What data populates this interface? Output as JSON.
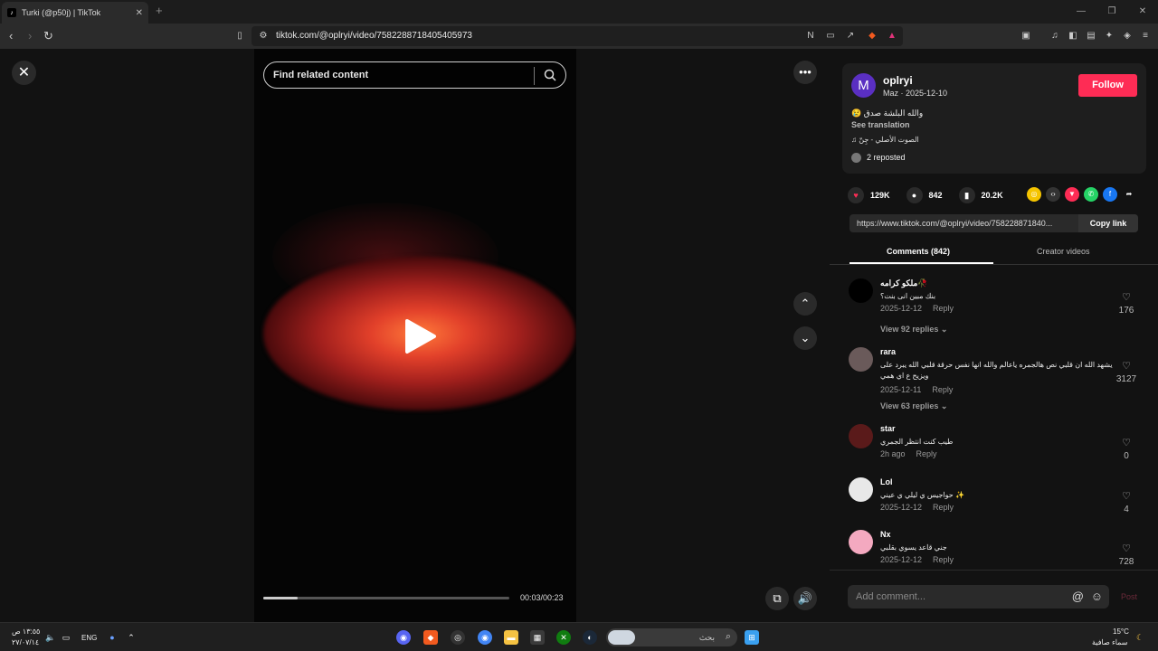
{
  "browser": {
    "tab_title": "Turki (@p50j) | TikTok",
    "url": "tiktok.com/@oplryi/video/7582288718405405973"
  },
  "video": {
    "search_placeholder": "Find related content",
    "time": "00:03/00:23",
    "progress_fraction": 0.14
  },
  "post": {
    "avatar_letter": "M",
    "username": "oplryi",
    "subline": "Maz · 2025-12-10",
    "caption": "😢 والله البلشة صدق",
    "see_translation": "See translation",
    "music": "♫  الصوت الأصلي - جِنّ",
    "reposted": "2 reposted",
    "follow_label": "Follow",
    "likes": "129K",
    "comments_count": "842",
    "saves": "20.2K",
    "share_link": "https://www.tiktok.com/@oplryi/video/758228871840...",
    "copy_link_label": "Copy link"
  },
  "tabs": {
    "comments": "Comments (842)",
    "creator_videos": "Creator videos"
  },
  "comments": [
    {
      "user": "ملكو كرامه🥀",
      "text": "بنك مبين انى بنت؟",
      "date": "2025-12-12",
      "reply": "Reply",
      "likes": "176",
      "replies": "View 92 replies ⌄",
      "avatar_color": "#000000"
    },
    {
      "user": "rara",
      "text": "يشهد الله ان قلبي نص هالجمره ياعالم والله انها نفس حرقة قلبي الله يبرد  على ويزيح ع اي همي",
      "date": "2025-12-11",
      "reply": "Reply",
      "likes": "3127",
      "replies": "View 63 replies ⌄",
      "avatar_color": "#6a5a5a"
    },
    {
      "user": "star",
      "text": "طيب كنت انتظر الجمري",
      "date": "2h ago",
      "reply": "Reply",
      "likes": "0",
      "avatar_color": "#5a1a1a"
    },
    {
      "user": "Lol",
      "text": "حواجيس ي ليلي ي عيني ✨",
      "date": "2025-12-12",
      "reply": "Reply",
      "likes": "4",
      "avatar_color": "#e8e8e8"
    },
    {
      "user": "Nx",
      "text": "جني قاعد يسوي بقلبي",
      "date": "2025-12-12",
      "reply": "Reply",
      "likes": "728",
      "avatar_color": "#f4a9c0"
    }
  ],
  "comment_box": {
    "placeholder": "Add comment...",
    "post_label": "Post"
  },
  "taskbar": {
    "time": "١٣:٥٥ ص",
    "date": "٢٧/٠٧/١٤",
    "lang": "ENG",
    "search_label": "بحث",
    "weather_temp": "15°C",
    "weather_desc": "سماء صافية"
  },
  "colors": {
    "follow": "#fe2c55",
    "avatar": "#5a2fc2",
    "like": "#fe2c55"
  }
}
